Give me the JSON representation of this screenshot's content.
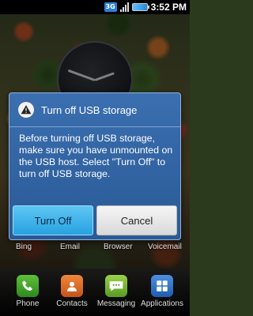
{
  "status_bar": {
    "network": "3G",
    "time": "3:52 PM"
  },
  "dialog": {
    "icon": "warning-icon",
    "title": "Turn off USB storage",
    "message": "Before turning off USB storage, make sure you have unmounted on the USB host. Select \"Turn Off\" to turn off USB storage.",
    "primary_button": "Turn Off",
    "secondary_button": "Cancel"
  },
  "home_shortcuts": [
    {
      "label": "Bing"
    },
    {
      "label": "Email"
    },
    {
      "label": "Browser"
    },
    {
      "label": "Voicemail"
    }
  ],
  "dock": [
    {
      "label": "Phone",
      "icon": "phone-icon"
    },
    {
      "label": "Contacts",
      "icon": "contacts-icon"
    },
    {
      "label": "Messaging",
      "icon": "messaging-icon"
    },
    {
      "label": "Applications",
      "icon": "applications-icon"
    }
  ],
  "colors": {
    "dialog_bg": "#2f62a3",
    "primary_button": "#3bb3ea",
    "status_bar": "#000000"
  }
}
